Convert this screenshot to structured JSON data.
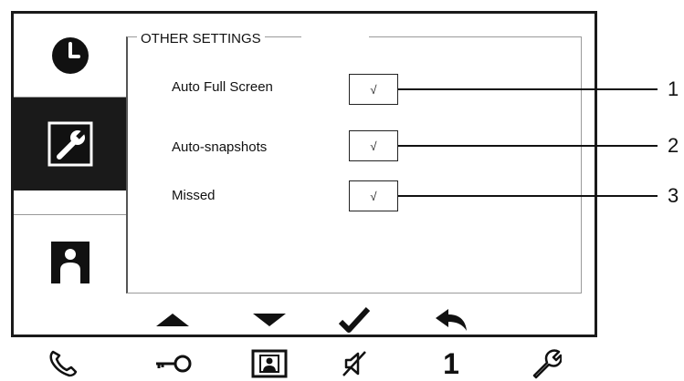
{
  "panel": {
    "title": "OTHER SETTINGS",
    "rows": [
      {
        "label": "Auto Full Screen",
        "checked": true,
        "check_glyph": "√",
        "callout": "1"
      },
      {
        "label": "Auto-snapshots",
        "checked": true,
        "check_glyph": "√",
        "callout": "2"
      },
      {
        "label": "Missed",
        "checked": true,
        "check_glyph": "√",
        "callout": "3"
      }
    ]
  },
  "sidebar": {
    "items": [
      {
        "icon": "clock-icon"
      },
      {
        "icon": "wrench-icon",
        "selected": true
      },
      {
        "icon": "person-icon"
      }
    ]
  },
  "bottom_bar": {
    "buttons": [
      {
        "icon": "arrow-up-icon"
      },
      {
        "icon": "arrow-down-icon"
      },
      {
        "icon": "check-icon"
      },
      {
        "icon": "back-icon"
      }
    ]
  },
  "hardware_buttons": [
    {
      "icon": "phone-icon"
    },
    {
      "icon": "key-icon"
    },
    {
      "icon": "monitor-person-icon"
    },
    {
      "icon": "mute-icon"
    },
    {
      "label": "1"
    },
    {
      "icon": "wrench-icon"
    }
  ]
}
